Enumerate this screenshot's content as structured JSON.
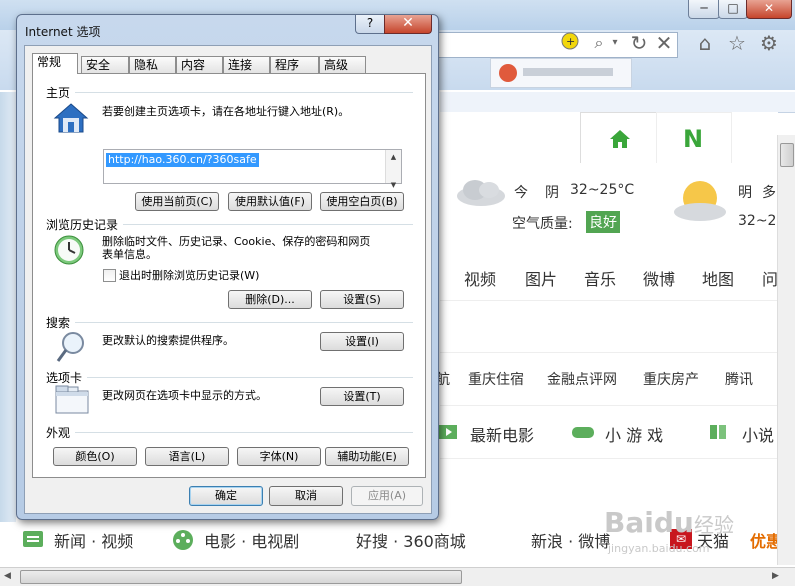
{
  "background_window": {
    "address_icons": [
      "shield-icon",
      "search-icon",
      "refresh-icon",
      "stop-icon"
    ],
    "toolbar_icons": [
      "home-icon",
      "star-icon",
      "gear-icon"
    ],
    "weather": {
      "today_label": "今",
      "condition": "阴",
      "temp": "32~25°C",
      "aqi_label": "空气质量:",
      "aqi_value": "良好",
      "tomorrow_label": "明",
      "tomorrow_condition": "多",
      "tomorrow_temp": "32~2"
    },
    "categories": [
      "视频",
      "图片",
      "音乐",
      "微博",
      "地图",
      "问"
    ],
    "links": [
      "航",
      "重庆住宿",
      "金融点评网",
      "重庆房产",
      "腾讯"
    ],
    "movies": [
      "最新电影",
      "小 游 戏",
      "小说"
    ],
    "bottom_links": [
      "新闻 · 视频",
      "电影 · 电视剧",
      "好搜 · 360商城",
      "新浪 · 微博",
      "天猫",
      "优惠"
    ],
    "tabs_icons": [
      "home-tab",
      "n-tab"
    ],
    "accent_green": "#3aa63a",
    "watermark": "Baidu 经验 jingyan.baidu.com"
  },
  "dialog": {
    "title": "Internet 选项",
    "help_label": "?",
    "close_label": "✕",
    "tabs": [
      "常规",
      "安全",
      "隐私",
      "内容",
      "连接",
      "程序",
      "高级"
    ],
    "active_tab": "常规",
    "home": {
      "heading": "主页",
      "desc": "若要创建主页选项卡，请在各地址行键入地址(R)。",
      "url": "http://hao.360.cn/?360safe",
      "btn_current": "使用当前页(C)",
      "btn_default": "使用默认值(F)",
      "btn_blank": "使用空白页(B)"
    },
    "history": {
      "heading": "浏览历史记录",
      "desc_line1": "删除临时文件、历史记录、Cookie、保存的密码和网页",
      "desc_line2": "表单信息。",
      "checkbox_label": "退出时删除浏览历史记录(W)",
      "checkbox_checked": false,
      "btn_delete": "删除(D)...",
      "btn_settings": "设置(S)"
    },
    "search": {
      "heading": "搜索",
      "desc": "更改默认的搜索提供程序。",
      "btn_settings": "设置(I)"
    },
    "tabs_section": {
      "heading": "选项卡",
      "desc": "更改网页在选项卡中显示的方式。",
      "btn_settings": "设置(T)"
    },
    "appearance": {
      "heading": "外观",
      "btn_colors": "颜色(O)",
      "btn_language": "语言(L)",
      "btn_fonts": "字体(N)",
      "btn_accessibility": "辅助功能(E)"
    },
    "footer": {
      "ok": "确定",
      "cancel": "取消",
      "apply": "应用(A)"
    }
  }
}
